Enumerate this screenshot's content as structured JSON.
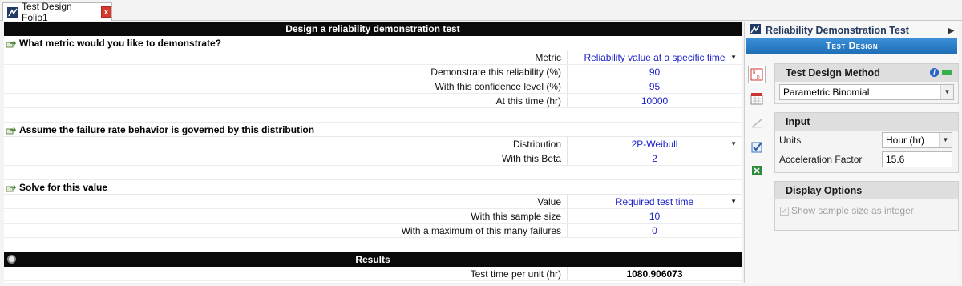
{
  "tab": {
    "title": "Test Design Folio1",
    "close_label": "x"
  },
  "sheet": {
    "title": "Design a reliability demonstration test",
    "sections": [
      {
        "heading": "What metric would you like to demonstrate?",
        "rows": [
          {
            "label": "Metric",
            "value": "Reliability value at a specific time",
            "dropdown": true
          },
          {
            "label": "Demonstrate this reliability (%)",
            "value": "90"
          },
          {
            "label": "With this confidence level (%)",
            "value": "95"
          },
          {
            "label": "At this time (hr)",
            "value": "10000"
          }
        ]
      },
      {
        "heading": "Assume the failure rate behavior is governed by this distribution",
        "rows": [
          {
            "label": "Distribution",
            "value": "2P-Weibull",
            "dropdown": true
          },
          {
            "label": "With this Beta",
            "value": "2"
          }
        ]
      },
      {
        "heading": "Solve for this value",
        "rows": [
          {
            "label": "Value",
            "value": "Required test time",
            "dropdown": true
          },
          {
            "label": "With this sample size",
            "value": "10"
          },
          {
            "label": "With a maximum of this many failures",
            "value": "0"
          }
        ]
      }
    ],
    "results": {
      "heading": "Results",
      "label": "Test time per unit (hr)",
      "value": "1080.906073"
    }
  },
  "panel": {
    "title": "Reliability Demonstration Test",
    "bar_label": "Test Design",
    "method": {
      "heading": "Test Design Method",
      "selected": "Parametric Binomial"
    },
    "input": {
      "heading": "Input",
      "units_label": "Units",
      "units_value": "Hour (hr)",
      "accel_label": "Acceleration Factor",
      "accel_value": "15.6"
    },
    "display": {
      "heading": "Display Options",
      "checkbox_label": "Show sample size as integer",
      "checked": true
    }
  },
  "colors": {
    "value_text": "#1e22c8",
    "header_bg": "#0a0a0a",
    "panel_accent": "#1f6fb8",
    "close_red": "#d63a2c"
  },
  "icons": [
    "folio-icon",
    "close-icon",
    "section-arrow-icon",
    "gear-icon",
    "rdt-logo-icon",
    "info-icon",
    "dropdown-icon",
    "tool-icons"
  ]
}
